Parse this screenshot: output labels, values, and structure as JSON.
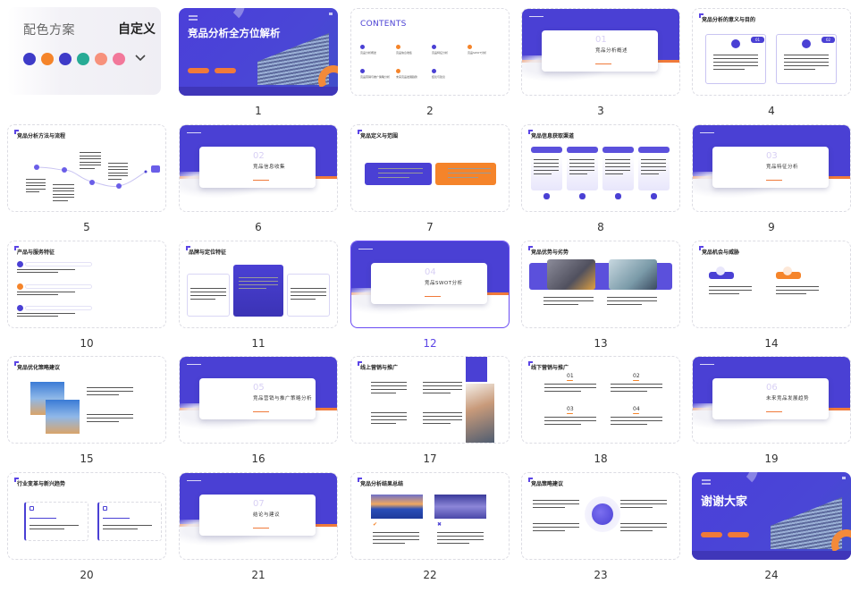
{
  "palette": {
    "label": "配色方案",
    "custom_label": "自定义",
    "swatches": [
      "#3e3bc8",
      "#f5842a",
      "#3e3bc8",
      "#27ab95",
      "#f7917c",
      "#f2789a"
    ],
    "expand_icon": "chevron-down-icon"
  },
  "accent_color": "#5b45e6",
  "selected_slide": 12,
  "slides": [
    {
      "number": "1",
      "type": "cover",
      "title": "竞品分析全方位解析"
    },
    {
      "number": "2",
      "type": "contents",
      "title": "CONTENTS",
      "items": [
        "竞品分析概述",
        "竞品信息收集",
        "竞品特征分析",
        "竞品SWOT分析",
        "竞品营销与推广策略分析",
        "未来竞品发展趋势",
        "结论与建议"
      ]
    },
    {
      "number": "3",
      "type": "section",
      "section_number": "01",
      "title": "竞品分析概述"
    },
    {
      "number": "4",
      "type": "content",
      "title": "竞品分析的意义与目的",
      "badges": [
        "01",
        "02"
      ]
    },
    {
      "number": "5",
      "type": "content",
      "title": "竞品分析方法与流程"
    },
    {
      "number": "6",
      "type": "section",
      "section_number": "02",
      "title": "竞品信息收集"
    },
    {
      "number": "7",
      "type": "content",
      "title": "竞品定义与范围"
    },
    {
      "number": "8",
      "type": "content",
      "title": "竞品信息获取渠道"
    },
    {
      "number": "9",
      "type": "section",
      "section_number": "03",
      "title": "竞品特征分析"
    },
    {
      "number": "10",
      "type": "content",
      "title": "产品与服务特征"
    },
    {
      "number": "11",
      "type": "content",
      "title": "品牌与定位特征"
    },
    {
      "number": "12",
      "type": "section",
      "section_number": "04",
      "title": "竞品SWOT分析"
    },
    {
      "number": "13",
      "type": "content",
      "title": "竞品优势与劣势"
    },
    {
      "number": "14",
      "type": "content",
      "title": "竞品机会与威胁"
    },
    {
      "number": "15",
      "type": "content",
      "title": "竞品优化策略建议"
    },
    {
      "number": "16",
      "type": "section",
      "section_number": "05",
      "title": "竞品营销与推广策略分析"
    },
    {
      "number": "17",
      "type": "content",
      "title": "线上营销与推广"
    },
    {
      "number": "18",
      "type": "content",
      "title": "线下营销与推广",
      "steps": [
        "01",
        "02",
        "03",
        "04"
      ]
    },
    {
      "number": "19",
      "type": "section",
      "section_number": "06",
      "title": "未来竞品发展趋势"
    },
    {
      "number": "20",
      "type": "content",
      "title": "行业变革与新兴趋势"
    },
    {
      "number": "21",
      "type": "section",
      "section_number": "07",
      "title": "结论与建议"
    },
    {
      "number": "22",
      "type": "content",
      "title": "竞品分析结果总结"
    },
    {
      "number": "23",
      "type": "content",
      "title": "竞品策略建议"
    },
    {
      "number": "24",
      "type": "cover",
      "title": "谢谢大家"
    }
  ]
}
